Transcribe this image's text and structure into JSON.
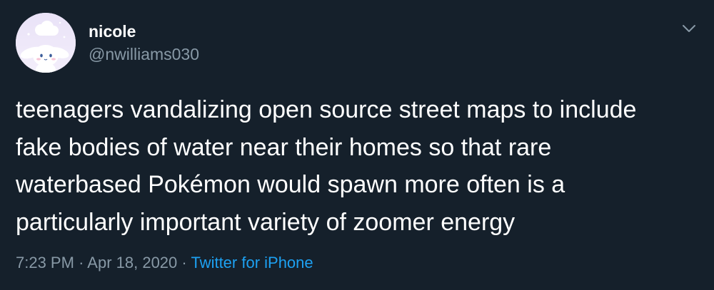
{
  "user": {
    "name": "nicole",
    "handle": "@nwilliams030"
  },
  "tweet": {
    "lines": [
      "teenagers vandalizing open source street maps to include",
      "fake bodies of water near their homes so that rare",
      "waterbased Pokémon would spawn more often is a",
      "particularly important variety of zoomer energy"
    ]
  },
  "meta": {
    "time": "7:23 PM",
    "separator": "·",
    "date": "Apr 18, 2020",
    "source": "Twitter for iPhone"
  },
  "icons": {
    "menu": "chevron-down-icon",
    "avatar": "cinnamoroll-avatar"
  },
  "colors": {
    "background": "#15202b",
    "text": "#ffffff",
    "secondary": "#8899a6",
    "link": "#1da1f2"
  }
}
